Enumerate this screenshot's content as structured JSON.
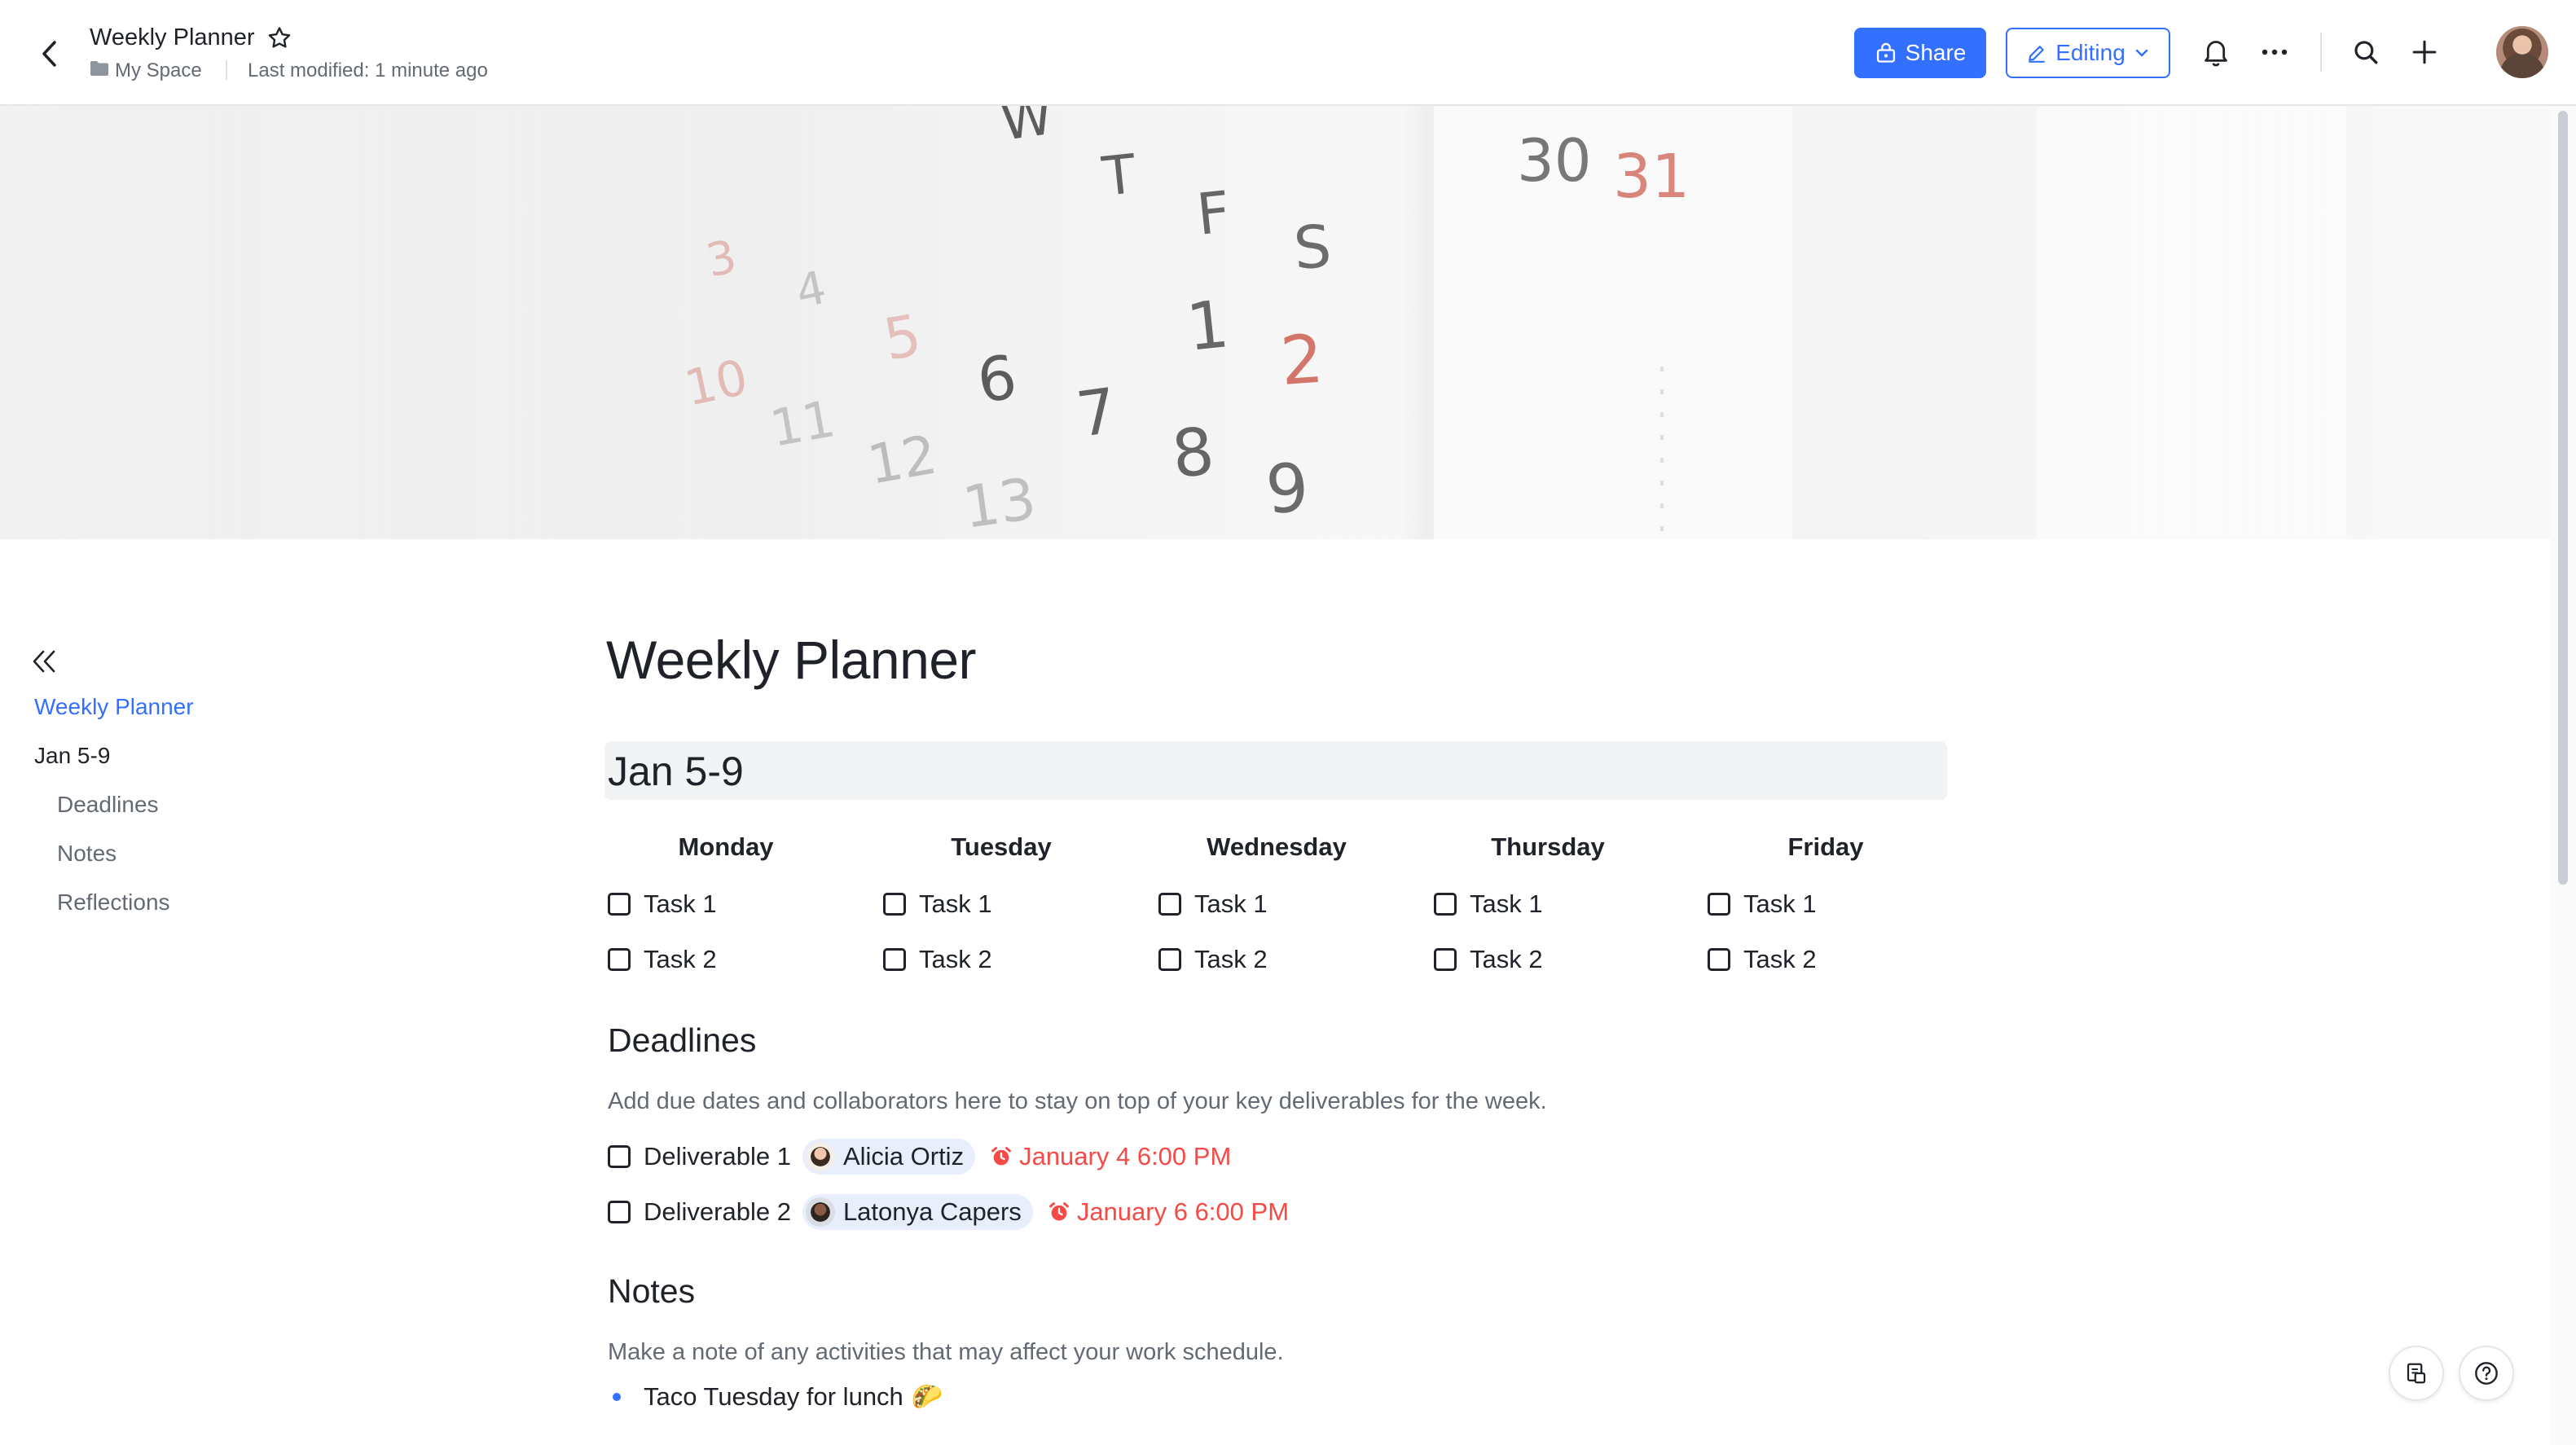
{
  "header": {
    "title": "Weekly Planner",
    "breadcrumb_space": "My Space",
    "last_modified": "Last modified: 1 minute ago",
    "share_label": "Share",
    "editing_label": "Editing"
  },
  "banner": {
    "calendar_glyphs": [
      "W",
      "T",
      "F",
      "S",
      "30",
      "31",
      "1",
      "2",
      "6",
      "7",
      "8",
      "9",
      "5",
      "4",
      "3",
      "12",
      "13",
      "11",
      "10"
    ]
  },
  "outline": {
    "items": [
      {
        "label": "Weekly Planner"
      },
      {
        "label": "Jan 5-9"
      },
      {
        "label": "Deadlines"
      },
      {
        "label": "Notes"
      },
      {
        "label": "Reflections"
      }
    ]
  },
  "doc": {
    "title": "Weekly Planner",
    "week_heading": "Jan 5-9",
    "days": [
      {
        "name": "Monday",
        "tasks": [
          "Task 1",
          "Task 2"
        ]
      },
      {
        "name": "Tuesday",
        "tasks": [
          "Task 1",
          "Task 2"
        ]
      },
      {
        "name": "Wednesday",
        "tasks": [
          "Task 1",
          "Task 2"
        ]
      },
      {
        "name": "Thursday",
        "tasks": [
          "Task 1",
          "Task 2"
        ]
      },
      {
        "name": "Friday",
        "tasks": [
          "Task 1",
          "Task 2"
        ]
      }
    ],
    "deadlines": {
      "heading": "Deadlines",
      "description": "Add due dates and collaborators here to stay on top of your key deliverables for the week.",
      "items": [
        {
          "label": "Deliverable 1",
          "assignee": "Alicia Ortiz",
          "due": "January 4 6:00 PM"
        },
        {
          "label": "Deliverable 2",
          "assignee": "Latonya Capers",
          "due": "January 6 6:00 PM"
        }
      ]
    },
    "notes": {
      "heading": "Notes",
      "description": "Make a note of any activities that may affect your work schedule.",
      "bullets": [
        {
          "text": "Taco Tuesday for lunch",
          "emoji": "🌮"
        }
      ]
    }
  },
  "colors": {
    "accent": "#3370ff",
    "due_red": "#f54a45",
    "text": "#1f2329",
    "muted": "#646a73"
  }
}
